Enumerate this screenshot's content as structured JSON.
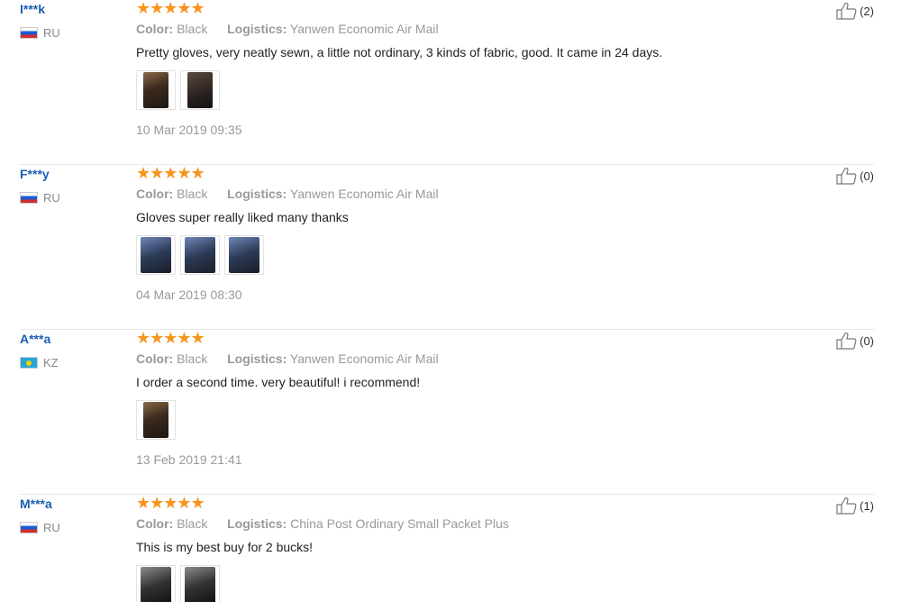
{
  "reviews": [
    {
      "user": "I***k",
      "country": "RU",
      "flag": "ru",
      "stars": "★★★★★",
      "color_label": "Color:",
      "color_value": "Black",
      "logistics_label": "Logistics:",
      "logistics_value": "Yanwen Economic Air Mail",
      "text": "Pretty gloves, very neatly sewn, a little not ordinary, 3 kinds of fabric, good. It came in 24 days.",
      "date": "10 Mar 2019 09:35",
      "likes": "(2)",
      "photos": [
        "glove-photo",
        "glove-photo"
      ]
    },
    {
      "user": "F***y",
      "country": "RU",
      "flag": "ru",
      "stars": "★★★★★",
      "color_label": "Color:",
      "color_value": "Black",
      "logistics_label": "Logistics:",
      "logistics_value": "Yanwen Economic Air Mail",
      "text": "Gloves super really liked many thanks",
      "date": "04 Mar 2019 08:30",
      "likes": "(0)",
      "photos": [
        "glove-photo",
        "glove-photo",
        "glove-photo"
      ]
    },
    {
      "user": "A***a",
      "country": "KZ",
      "flag": "kz",
      "stars": "★★★★★",
      "color_label": "Color:",
      "color_value": "Black",
      "logistics_label": "Logistics:",
      "logistics_value": "Yanwen Economic Air Mail",
      "text": "I order a second time. very beautiful! i recommend!",
      "date": "13 Feb 2019 21:41",
      "likes": "(0)",
      "photos": [
        "glove-photo"
      ]
    },
    {
      "user": "M***a",
      "country": "RU",
      "flag": "ru",
      "stars": "★★★★★",
      "color_label": "Color:",
      "color_value": "Black",
      "logistics_label": "Logistics:",
      "logistics_value": "China Post Ordinary Small Packet Plus",
      "text": "This is my best buy for 2 bucks!",
      "date": "",
      "likes": "(1)",
      "photos": [
        "glove-photo",
        "glove-photo"
      ]
    }
  ],
  "colors": {
    "username": "#1a5fb4",
    "stars": "#f7941d",
    "meta": "#999999"
  }
}
